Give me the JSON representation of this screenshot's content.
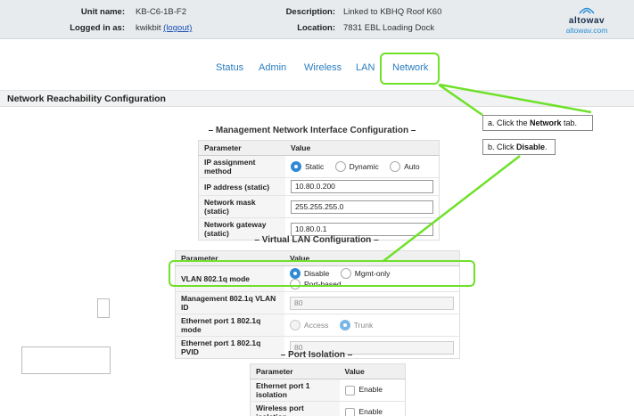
{
  "header": {
    "unit_name_label": "Unit name:",
    "unit_name": "KB-C6-1B-F2",
    "logged_in_label": "Logged in as:",
    "logged_in_user": "kwikbit",
    "logout_text": "(logout)",
    "description_label": "Description:",
    "description": "Linked to KBHQ Roof K60",
    "location_label": "Location:",
    "location": "7831 EBL Loading Dock",
    "logo_mark": "altowav",
    "logo_url": "altowav.com"
  },
  "nav": {
    "tabs": [
      {
        "label": "Status"
      },
      {
        "label": "Admin"
      },
      {
        "label": "Wireless"
      },
      {
        "label": "LAN"
      },
      {
        "label": "Network",
        "active": true
      }
    ]
  },
  "section_title": "Network Reachability Configuration",
  "notes": {
    "a_prefix": "a. Click the ",
    "a_bold": "Network",
    "a_suffix": " tab.",
    "b_prefix": "b. Click ",
    "b_bold": "Disable",
    "b_suffix": "."
  },
  "mgmt": {
    "title": "– Management Network Interface Configuration –",
    "col_param": "Parameter",
    "col_value": "Value",
    "ip_method_label": "IP assignment method",
    "ip_method_options": [
      "Static",
      "Dynamic",
      "Auto"
    ],
    "ip_method_selected": "Static",
    "ip_label": "IP address (static)",
    "ip_value": "10.80.0.200",
    "mask_label": "Network mask (static)",
    "mask_value": "255.255.255.0",
    "gw_label": "Network gateway (static)",
    "gw_value": "10.80.0.1"
  },
  "vlan": {
    "title": "– Virtual LAN Configuration –",
    "col_param": "Parameter",
    "col_value": "Value",
    "mode_label": "VLAN 802.1q mode",
    "mode_options": [
      "Disable",
      "Mgmt-only",
      "Port-based"
    ],
    "mode_selected": "Disable",
    "mgmt_vlan_label": "Management 802.1q VLAN ID",
    "mgmt_vlan_value": "80",
    "eth_mode_label": "Ethernet port 1 802.1q mode",
    "eth_mode_options": [
      "Access",
      "Trunk"
    ],
    "eth_mode_selected": "Trunk",
    "pvid_label": "Ethernet port 1 802.1q PVID",
    "pvid_value": "80"
  },
  "isolation": {
    "title": "– Port Isolation –",
    "col_param": "Parameter",
    "col_value": "Value",
    "eth_label": "Ethernet port 1 isolation",
    "eth_option": "Enable",
    "wifi_label": "Wireless port isolation",
    "wifi_option": "Enable"
  },
  "colors": {
    "highlight": "#6fe12a",
    "link": "#2a7dc0",
    "radio_selected": "#2f8ad6"
  }
}
